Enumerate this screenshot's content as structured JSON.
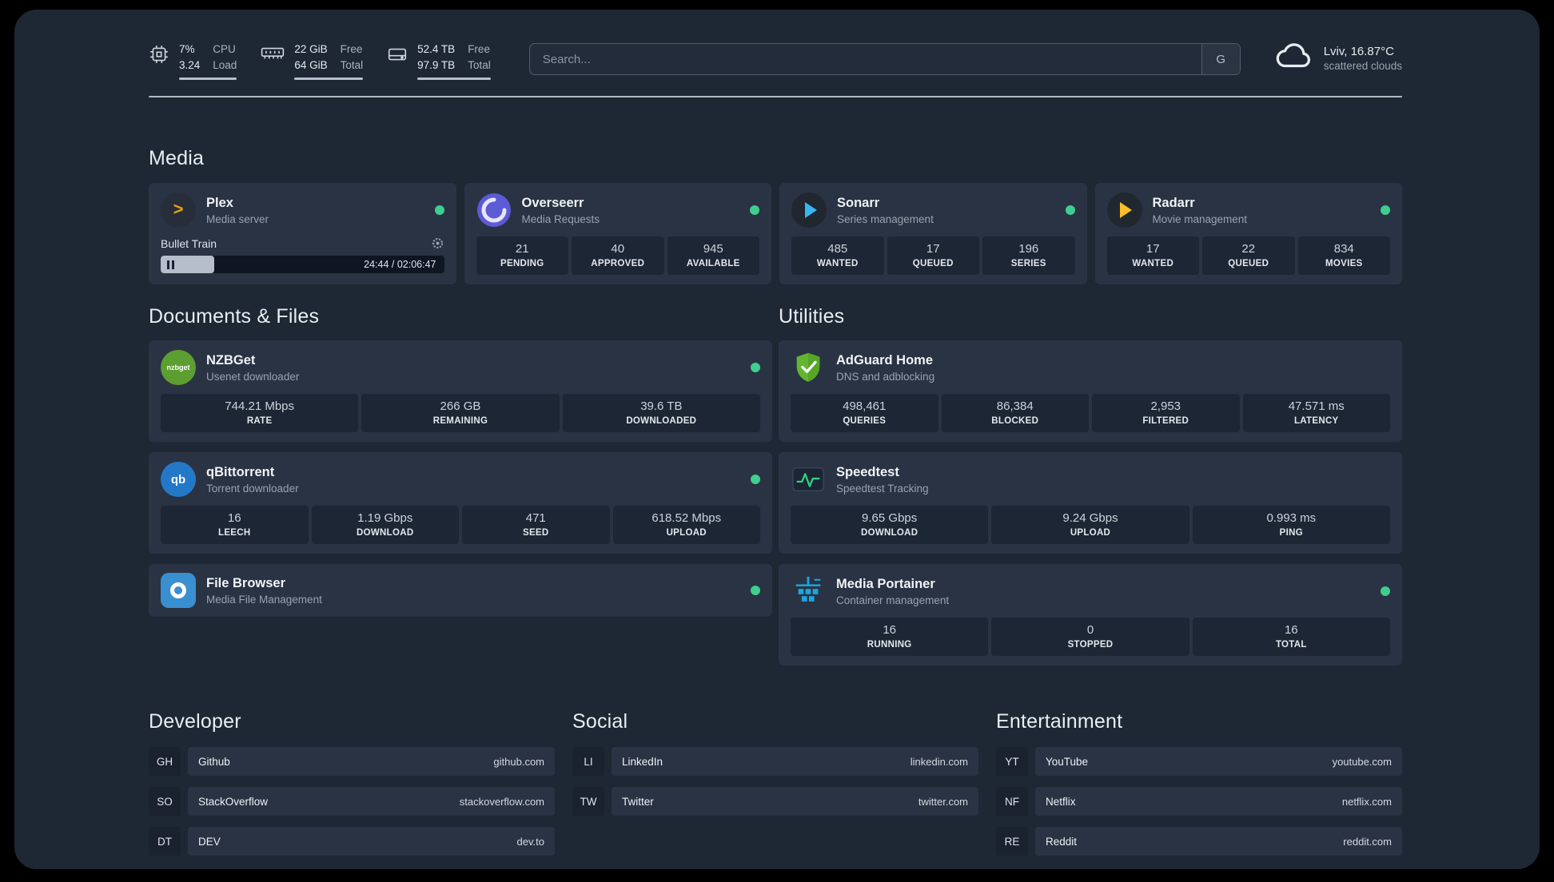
{
  "topbar": {
    "monitors": [
      {
        "name": "cpu",
        "v1": "7%",
        "v2": "3.24",
        "l1": "CPU",
        "l2": "Load"
      },
      {
        "name": "memory",
        "v1": "22 GiB",
        "v2": "64 GiB",
        "l1": "Free",
        "l2": "Total"
      },
      {
        "name": "disk",
        "v1": "52.4 TB",
        "v2": "97.9 TB",
        "l1": "Free",
        "l2": "Total"
      }
    ],
    "search": {
      "placeholder": "Search...",
      "provider": "G"
    },
    "weather": {
      "location": "Lviv, 16.87°C",
      "condition": "scattered clouds"
    }
  },
  "colors": {
    "status_online": "#3ecf8e",
    "accent_green": "#2fd180"
  },
  "sections": {
    "media": {
      "title": "Media",
      "cards": [
        {
          "name": "Plex",
          "desc": "Media server",
          "player": {
            "track": "Bullet Train",
            "time": "24:44 / 02:06:47"
          }
        },
        {
          "name": "Overseerr",
          "desc": "Media Requests",
          "stats": [
            {
              "value": "21",
              "label": "PENDING"
            },
            {
              "value": "40",
              "label": "APPROVED"
            },
            {
              "value": "945",
              "label": "AVAILABLE"
            }
          ]
        },
        {
          "name": "Sonarr",
          "desc": "Series management",
          "stats": [
            {
              "value": "485",
              "label": "WANTED"
            },
            {
              "value": "17",
              "label": "QUEUED"
            },
            {
              "value": "196",
              "label": "SERIES"
            }
          ]
        },
        {
          "name": "Radarr",
          "desc": "Movie management",
          "stats": [
            {
              "value": "17",
              "label": "WANTED"
            },
            {
              "value": "22",
              "label": "QUEUED"
            },
            {
              "value": "834",
              "label": "MOVIES"
            }
          ]
        }
      ]
    },
    "documents": {
      "title": "Documents & Files",
      "cards": [
        {
          "name": "NZBGet",
          "desc": "Usenet downloader",
          "stats": [
            {
              "value": "744.21 Mbps",
              "label": "RATE"
            },
            {
              "value": "266 GB",
              "label": "REMAINING"
            },
            {
              "value": "39.6 TB",
              "label": "DOWNLOADED"
            }
          ]
        },
        {
          "name": "qBittorrent",
          "desc": "Torrent downloader",
          "stats": [
            {
              "value": "16",
              "label": "LEECH"
            },
            {
              "value": "1.19 Gbps",
              "label": "DOWNLOAD"
            },
            {
              "value": "471",
              "label": "SEED"
            },
            {
              "value": "618.52 Mbps",
              "label": "UPLOAD"
            }
          ]
        },
        {
          "name": "File Browser",
          "desc": "Media File Management"
        }
      ]
    },
    "utilities": {
      "title": "Utilities",
      "cards": [
        {
          "name": "AdGuard Home",
          "desc": "DNS and adblocking",
          "stats": [
            {
              "value": "498,461",
              "label": "QUERIES"
            },
            {
              "value": "86,384",
              "label": "BLOCKED"
            },
            {
              "value": "2,953",
              "label": "FILTERED"
            },
            {
              "value": "47.571 ms",
              "label": "LATENCY"
            }
          ]
        },
        {
          "name": "Speedtest",
          "desc": "Speedtest Tracking",
          "stats": [
            {
              "value": "9.65 Gbps",
              "label": "DOWNLOAD"
            },
            {
              "value": "9.24 Gbps",
              "label": "UPLOAD"
            },
            {
              "value": "0.993 ms",
              "label": "PING"
            }
          ]
        },
        {
          "name": "Media Portainer",
          "desc": "Container management",
          "stats": [
            {
              "value": "16",
              "label": "RUNNING"
            },
            {
              "value": "0",
              "label": "STOPPED"
            },
            {
              "value": "16",
              "label": "TOTAL"
            }
          ]
        }
      ]
    }
  },
  "bookmarks": {
    "groups": [
      {
        "title": "Developer",
        "items": [
          {
            "abbr": "GH",
            "name": "Github",
            "url": "github.com"
          },
          {
            "abbr": "SO",
            "name": "StackOverflow",
            "url": "stackoverflow.com"
          },
          {
            "abbr": "DT",
            "name": "DEV",
            "url": "dev.to"
          }
        ]
      },
      {
        "title": "Social",
        "items": [
          {
            "abbr": "LI",
            "name": "LinkedIn",
            "url": "linkedin.com"
          },
          {
            "abbr": "TW",
            "name": "Twitter",
            "url": "twitter.com"
          }
        ]
      },
      {
        "title": "Entertainment",
        "items": [
          {
            "abbr": "YT",
            "name": "YouTube",
            "url": "youtube.com"
          },
          {
            "abbr": "NF",
            "name": "Netflix",
            "url": "netflix.com"
          },
          {
            "abbr": "RE",
            "name": "Reddit",
            "url": "reddit.com"
          }
        ]
      }
    ]
  }
}
